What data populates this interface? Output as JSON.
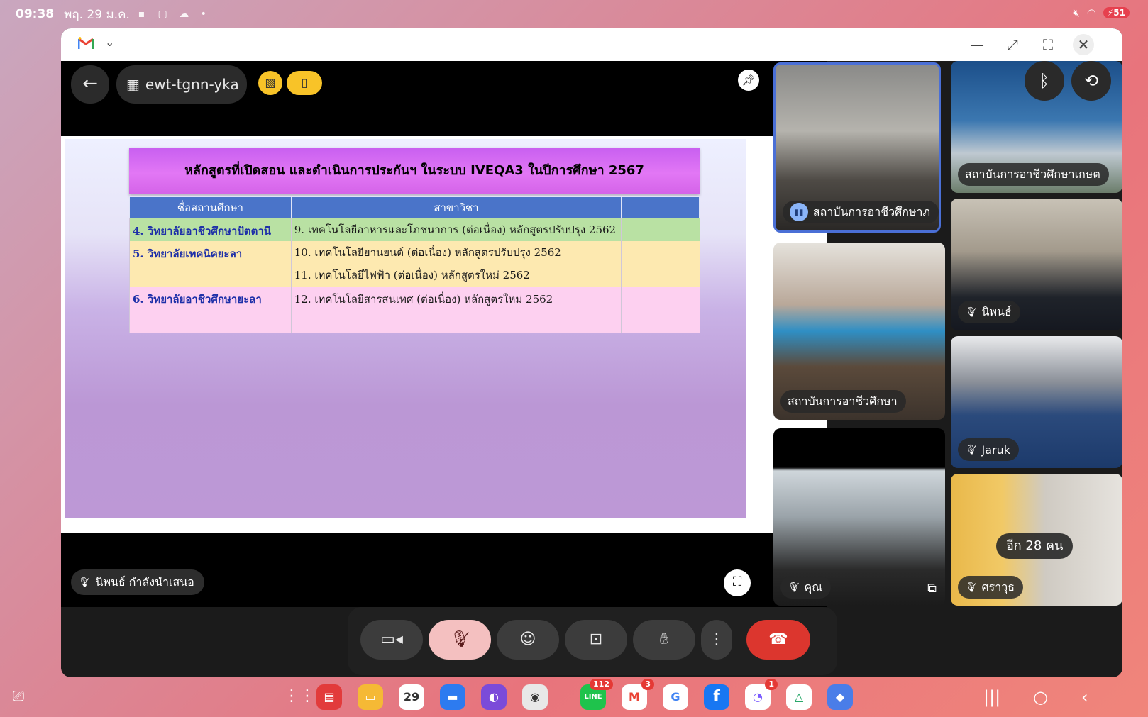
{
  "status_bar": {
    "time": "09:38",
    "date": "พฤ. 29 ม.ค.",
    "battery": "51"
  },
  "meeting": {
    "code": "ewt-tgnn-yka",
    "presenting_label": "นิพนธ์ กำลังนำเสนอ"
  },
  "slide": {
    "title": "หลักสูตรที่เปิดสอน และดำเนินการประกันฯ ในระบบ IVEQA3  ในปีการศึกษา 2567",
    "col_institution": "ชื่อสถานศึกษา",
    "col_program": "สาขาวิชา",
    "rows": [
      {
        "institution": "4. วิทยาลัยอาชีวศึกษาปัตตานี",
        "program": "9. เทคโนโลยีอาหารและโภชนาการ (ต่อเนื่อง) หลักสูตรปรับปรุง 2562"
      },
      {
        "institution": "5. วิทยาลัยเทคนิคยะลา",
        "program": "10. เทคโนโลยียานยนต์ (ต่อเนื่อง) หลักสูตรปรับปรุง 2562"
      },
      {
        "institution": "",
        "program": "11. เทคโนโลยีไฟฟ้า (ต่อเนื่อง) หลักสูตรใหม่ 2562"
      },
      {
        "institution": "6. วิทยาลัยอาชีวศึกษายะลา",
        "program": "12. เทคโนโลยีสารสนเทศ (ต่อเนื่อง) หลักสูตรใหม่ 2562"
      }
    ]
  },
  "participants": [
    {
      "name": "สถาบันการอาชีวศึกษาภ"
    },
    {
      "name": "สถาบันการอาชีวศึกษาเกษต"
    },
    {
      "name": "สถาบันการอาชีวศึกษา"
    },
    {
      "name": "นิพนธ์"
    },
    {
      "name": "Jaruk"
    },
    {
      "name": "คุณ"
    },
    {
      "name": "ศราวุธ"
    }
  ],
  "others_count_label": "อีก 28 คน",
  "dock": {
    "calendar_day": "29",
    "line_badge": "112",
    "gmail_badge": "3",
    "messenger_badge": "1",
    "line_label": "LINE"
  },
  "icons": [
    "gmail-icon",
    "chevron-down-icon",
    "minimize-icon",
    "expand-icon",
    "fullscreen-icon",
    "close-icon",
    "back-arrow-icon",
    "calendar-icon",
    "bluetooth-icon",
    "camera-switch-icon",
    "pin-icon",
    "mic-off-icon",
    "camera-icon",
    "emoji-icon",
    "present-icon",
    "hand-icon",
    "more-icon",
    "end-call-icon"
  ],
  "colors": {
    "header_purple": "#d463e8",
    "table_blue": "#4a74c9",
    "end_call_red": "#dc362e",
    "mic_off_pink": "#f4c0c0",
    "badge_yellow": "#f8c328"
  }
}
